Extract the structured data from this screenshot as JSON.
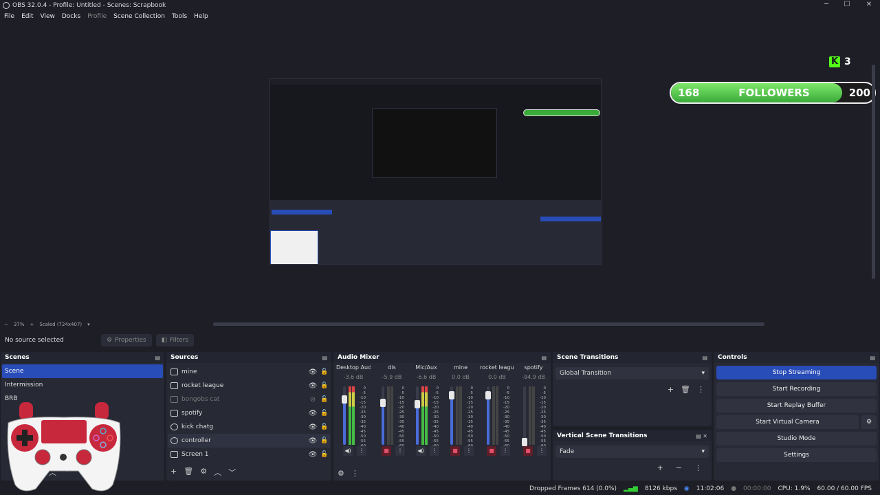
{
  "window": {
    "title": "OBS 32.0.4 - Profile: Untitled - Scenes: Scrapbook",
    "minimize": "─",
    "maximize": "☐",
    "close": "✕"
  },
  "menu": [
    "File",
    "Edit",
    "View",
    "Docks",
    "Profile",
    "Scene Collection",
    "Tools",
    "Help"
  ],
  "overlay": {
    "kick_count": "3",
    "followers_current": "168",
    "followers_label": "FOLLOWERS",
    "followers_goal": "200",
    "followers_progress": 0.84
  },
  "preview_bar": {
    "minus": "−",
    "zoom": "37%",
    "plus": "+",
    "scale": "Scaled (724x407)",
    "arrow": "▾"
  },
  "context_bar": {
    "no_source": "No source selected",
    "properties": "Properties",
    "filters": "Filters"
  },
  "scenes": {
    "title": "Scenes",
    "items": [
      "Scene",
      "Intermission",
      "BRB"
    ],
    "selected": 0
  },
  "sources": {
    "title": "Sources",
    "items": [
      {
        "name": "mine",
        "visible": true
      },
      {
        "name": "rocket league",
        "visible": true
      },
      {
        "name": "bongobs cat",
        "visible": false
      },
      {
        "name": "spotify",
        "visible": true
      },
      {
        "name": "kick chatg",
        "visible": true
      },
      {
        "name": "controller",
        "visible": true
      },
      {
        "name": "Screen 1",
        "visible": true
      }
    ]
  },
  "audio_mixer": {
    "title": "Audio Mixer",
    "channels": [
      {
        "name": "Desktop Audio",
        "db": "-3.6 dB",
        "level": 0.78,
        "muted": false
      },
      {
        "name": "dis",
        "db": "-5.9 dB",
        "level": 0.72,
        "muted": true
      },
      {
        "name": "Mic/Aux",
        "db": "-6.6 dB",
        "level": 0.7,
        "muted": false
      },
      {
        "name": "mine",
        "db": "0.0 dB",
        "level": 0.85,
        "muted": true
      },
      {
        "name": "rocket league",
        "db": "0.0 dB",
        "level": 0.85,
        "muted": true
      },
      {
        "name": "spotify",
        "db": "-94.9 dB",
        "level": 0.05,
        "muted": true
      }
    ],
    "scale": [
      "0",
      "-5",
      "-10",
      "-15",
      "-20",
      "-25",
      "-30",
      "-35",
      "-40",
      "-45",
      "-50",
      "-55",
      "-60"
    ]
  },
  "scene_transitions": {
    "title": "Scene Transitions",
    "selected": "Global Transition"
  },
  "vertical_transitions": {
    "title": "Vertical Scene Transitions",
    "selected": "Fade"
  },
  "controls": {
    "title": "Controls",
    "buttons": [
      "Stop Streaming",
      "Start Recording",
      "Start Replay Buffer",
      "Start Virtual Camera",
      "Studio Mode",
      "Settings"
    ]
  },
  "status": {
    "dropped": "Dropped Frames 614 (0.0%)",
    "kbps": "8126 kbps",
    "stream_time": "11:02:06",
    "rec_time": "00:00:00",
    "cpu": "CPU: 1.9%",
    "fps": "60.00 / 60.00 FPS"
  },
  "colors": {
    "accent": "#284cb8",
    "mute": "#e0506a",
    "kick": "#53fc18"
  }
}
